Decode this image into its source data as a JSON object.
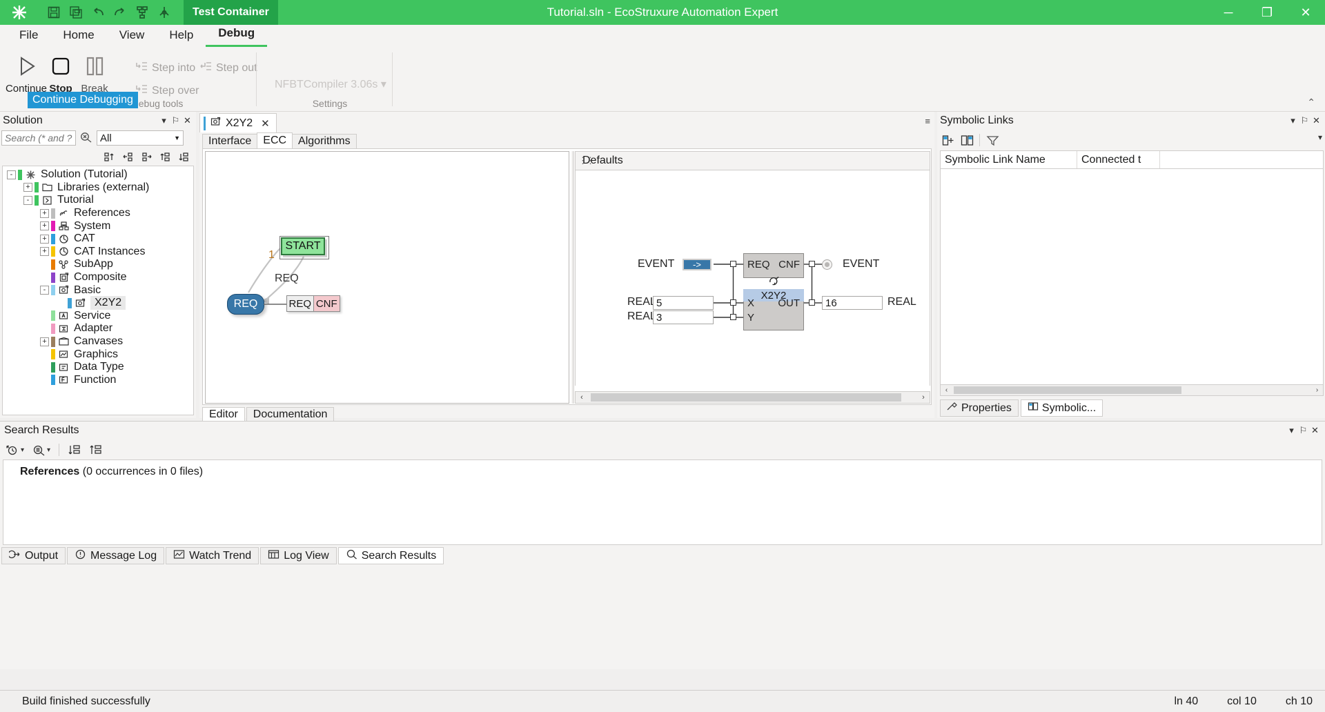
{
  "titlebar": {
    "app_title": "Tutorial.sln - EcoStruxure Automation Expert",
    "test_container_label": "Test Container",
    "quick_access": [
      {
        "name": "save-icon",
        "glyph": "💾"
      },
      {
        "name": "save-all-icon",
        "glyph": "🗃"
      },
      {
        "name": "undo-icon",
        "glyph": "↶"
      },
      {
        "name": "redo-icon",
        "glyph": "↷"
      },
      {
        "name": "deploy-icon",
        "glyph": "⑂"
      },
      {
        "name": "connect-icon",
        "glyph": "✥"
      }
    ],
    "window_buttons": {
      "minimize": "─",
      "restore": "❐",
      "close": "✕"
    }
  },
  "menubar": {
    "items": [
      {
        "label": "File",
        "active": false
      },
      {
        "label": "Home",
        "active": false
      },
      {
        "label": "View",
        "active": false
      },
      {
        "label": "Help",
        "active": false
      },
      {
        "label": "Debug",
        "active": true
      }
    ]
  },
  "ribbon": {
    "continue_label": "Continue",
    "stop_label": "Stop",
    "break_label": "Break",
    "step_into_label": "Step into",
    "step_out_label": "Step out",
    "step_over_label": "Step over",
    "debug_tools_group": "Debug tools",
    "settings_group": "Settings",
    "compiler_label": "NFBTCompiler 3.06s",
    "collapse_glyph": "⌃"
  },
  "tooltip": {
    "text": "Continue Debugging"
  },
  "solution_explorer": {
    "title": "Solution",
    "header_buttons": {
      "dropdown": "▾",
      "pin": "⚐",
      "close": "✕"
    },
    "search_placeholder": "Search (* and ? allow",
    "clear_icon": "search-clear-icon",
    "filter_value": "All",
    "toolbar_icons": [
      "collapse-all-icon",
      "sync-back-icon",
      "sync-forward-icon",
      "sort-up-icon",
      "sort-down-icon"
    ],
    "tree": [
      {
        "label": "Solution  (Tutorial)",
        "depth": 0,
        "expander": "-",
        "bar": "#3fc45f",
        "icon": "solution-icon",
        "selected": false
      },
      {
        "label": "Libraries (external)",
        "depth": 1,
        "expander": "+",
        "bar": "#3fc45f",
        "icon": "folder-icon",
        "selected": false
      },
      {
        "label": "Tutorial",
        "depth": 1,
        "expander": "-",
        "bar": "#3fc45f",
        "icon": "project-icon",
        "selected": false
      },
      {
        "label": "References",
        "depth": 2,
        "expander": "+",
        "bar": "#bdbdbd",
        "icon": "references-icon",
        "selected": false
      },
      {
        "label": "System",
        "depth": 2,
        "expander": "+",
        "bar": "#e21ab4",
        "icon": "system-icon",
        "selected": false
      },
      {
        "label": "CAT",
        "depth": 2,
        "expander": "+",
        "bar": "#2f9fdc",
        "icon": "cat-icon",
        "selected": false
      },
      {
        "label": "CAT Instances",
        "depth": 2,
        "expander": "+",
        "bar": "#f5c400",
        "icon": "cat-instances-icon",
        "selected": false
      },
      {
        "label": "SubApp",
        "depth": 2,
        "expander": "",
        "bar": "#e87b00",
        "icon": "subapp-icon",
        "selected": false
      },
      {
        "label": "Composite",
        "depth": 2,
        "expander": "",
        "bar": "#8e44c9",
        "icon": "composite-icon",
        "selected": false
      },
      {
        "label": "Basic",
        "depth": 2,
        "expander": "-",
        "bar": "#8fd0ef",
        "icon": "basic-icon",
        "selected": false
      },
      {
        "label": "X2Y2",
        "depth": 3,
        "expander": "",
        "bar": "#3fa2d6",
        "icon": "basic-fb-icon",
        "selected": true
      },
      {
        "label": "Service",
        "depth": 2,
        "expander": "",
        "bar": "#8fe09b",
        "icon": "service-icon",
        "selected": false
      },
      {
        "label": "Adapter",
        "depth": 2,
        "expander": "",
        "bar": "#f09bc0",
        "icon": "adapter-icon",
        "selected": false
      },
      {
        "label": "Canvases",
        "depth": 2,
        "expander": "+",
        "bar": "#9b7f5e",
        "icon": "canvases-icon",
        "selected": false
      },
      {
        "label": "Graphics",
        "depth": 2,
        "expander": "",
        "bar": "#f5c400",
        "icon": "graphics-icon",
        "selected": false
      },
      {
        "label": "Data Type",
        "depth": 2,
        "expander": "",
        "bar": "#2e9e5b",
        "icon": "datatype-icon",
        "selected": false
      },
      {
        "label": "Function",
        "depth": 2,
        "expander": "",
        "bar": "#2f9fdc",
        "icon": "function-icon",
        "selected": false
      }
    ]
  },
  "editor": {
    "document_tab": {
      "label": "X2Y2",
      "close_glyph": "✕"
    },
    "chevron_glyph": "≡",
    "inner_tabs": [
      {
        "label": "Interface",
        "active": false
      },
      {
        "label": "ECC",
        "active": true
      },
      {
        "label": "Algorithms",
        "active": false
      }
    ],
    "bottom_tabs": [
      {
        "label": "Editor",
        "active": true
      },
      {
        "label": "Documentation",
        "active": false
      }
    ],
    "ecc": {
      "start_state": "START",
      "req_state": "REQ",
      "action_event": "REQ",
      "action_output": "CNF",
      "transition_label": "1",
      "transition_condition": "REQ"
    },
    "defaults_panel": {
      "title": "Defaults",
      "event_in_label": "EVENT",
      "event_in_value": "->",
      "event_out_label": "EVENT",
      "fb_name": "X2Y2",
      "pin_req": "REQ",
      "pin_cnf": "CNF",
      "pin_x": "X",
      "pin_y": "Y",
      "pin_out": "OUT",
      "x_type": "REAL",
      "y_type": "REAL",
      "out_type": "REAL",
      "x_value": "5",
      "y_value": "3",
      "out_value": "16"
    },
    "scroll_arrows": {
      "left": "‹",
      "right": "›"
    }
  },
  "symbolic_links": {
    "title": "Symbolic Links",
    "header_buttons": {
      "dropdown": "▾",
      "pin": "⚐",
      "close": "✕"
    },
    "toolbar_icons": [
      "add-symbolic-link-icon",
      "remove-symbolic-link-icon",
      "filter-icon"
    ],
    "columns": [
      {
        "label": "Symbolic Link Name",
        "width": 198
      },
      {
        "label": "Connected t",
        "width": 120
      }
    ],
    "rows": [],
    "scroll_arrows": {
      "left": "‹",
      "right": "›"
    },
    "tabs": [
      {
        "label": "Properties",
        "icon": "properties-icon",
        "active": false
      },
      {
        "label": "Symbolic...",
        "icon": "symbolic-icon",
        "active": true
      }
    ]
  },
  "search_results": {
    "title": "Search Results",
    "header_buttons": {
      "dropdown": "▾",
      "pin": "⚐",
      "close": "✕"
    },
    "toolbar_icons": [
      "history-icon",
      "search-options-icon",
      "sort-desc-icon",
      "sort-asc-icon"
    ],
    "result_heading": "References",
    "result_detail": "(0 occurrences in 0 files)",
    "tabs": [
      {
        "label": "Output",
        "icon": "output-icon",
        "active": false
      },
      {
        "label": "Message Log",
        "icon": "message-log-icon",
        "active": false
      },
      {
        "label": "Watch Trend",
        "icon": "watch-trend-icon",
        "active": false
      },
      {
        "label": "Log View",
        "icon": "log-view-icon",
        "active": false
      },
      {
        "label": "Search Results",
        "icon": "search-results-icon",
        "active": true
      }
    ]
  },
  "statusbar": {
    "message": "Build finished successfully",
    "line": "ln 40",
    "col": "col 10",
    "ch": "ch 10"
  },
  "colors": {
    "brand_green": "#3fc45f",
    "brand_green_dark": "#23a349",
    "accent_blue": "#3877a8",
    "tooltip_blue": "#2196d4",
    "state_green": "#8fe49b",
    "chrome": "#f4f3f2"
  }
}
